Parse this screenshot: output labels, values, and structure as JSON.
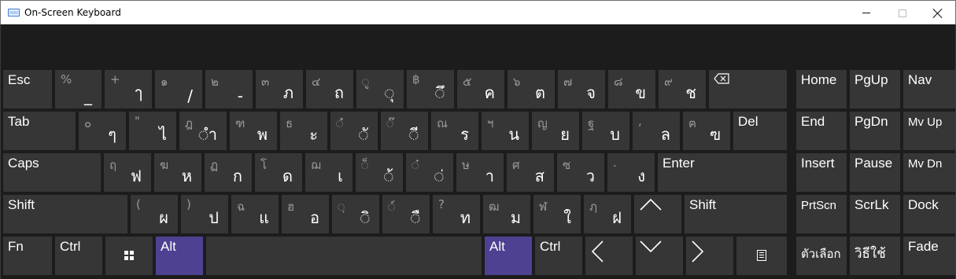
{
  "window": {
    "title": "On-Screen Keyboard",
    "minimize_icon": "minimize-icon",
    "maximize_icon": "maximize-icon",
    "close_icon": "close-icon"
  },
  "colors": {
    "key": "#363636",
    "key_active": "#4e4192",
    "background": "#1c1c1c",
    "shift_char": "#9a9a9a"
  },
  "rows": {
    "row1": [
      {
        "label": "Esc"
      },
      {
        "shift": "%",
        "base": "_"
      },
      {
        "shift": "+",
        "base": "ๅ"
      },
      {
        "shift": "๑",
        "base": "/"
      },
      {
        "shift": "๒",
        "base": "-"
      },
      {
        "shift": "๓",
        "base": "ภ"
      },
      {
        "shift": "๔",
        "base": "ถ"
      },
      {
        "shift": "◌ู",
        "base": "◌ุ"
      },
      {
        "shift": "฿",
        "base": "◌ึ"
      },
      {
        "shift": "๕",
        "base": "ค"
      },
      {
        "shift": "๖",
        "base": "ต"
      },
      {
        "shift": "๗",
        "base": "จ"
      },
      {
        "shift": "๘",
        "base": "ข"
      },
      {
        "shift": "๙",
        "base": "ช"
      },
      {
        "icon": "backspace-icon"
      }
    ],
    "row2": [
      {
        "label": "Tab"
      },
      {
        "shift": "๐",
        "base": "ๆ"
      },
      {
        "shift": "\"",
        "base": "ไ"
      },
      {
        "shift": "ฎ",
        "base": "◌ำ"
      },
      {
        "shift": "ฑ",
        "base": "พ"
      },
      {
        "shift": "ธ",
        "base": "ะ"
      },
      {
        "shift": "◌ํ",
        "base": "◌ั"
      },
      {
        "shift": "◌๊",
        "base": "◌ี"
      },
      {
        "shift": "ณ",
        "base": "ร"
      },
      {
        "shift": "ฯ",
        "base": "น"
      },
      {
        "shift": "ญ",
        "base": "ย"
      },
      {
        "shift": "ฐ",
        "base": "บ"
      },
      {
        "shift": ",",
        "base": "ล"
      },
      {
        "shift": "ฅ",
        "base": "ฃ"
      },
      {
        "label": "Del"
      }
    ],
    "row3": [
      {
        "label": "Caps"
      },
      {
        "shift": "ฤ",
        "base": "ฟ"
      },
      {
        "shift": "ฆ",
        "base": "ห"
      },
      {
        "shift": "ฏ",
        "base": "ก"
      },
      {
        "shift": "โ",
        "base": "ด"
      },
      {
        "shift": "ฌ",
        "base": "เ"
      },
      {
        "shift": "◌็",
        "base": "◌้"
      },
      {
        "shift": "◌๋",
        "base": "◌่"
      },
      {
        "shift": "ษ",
        "base": "า"
      },
      {
        "shift": "ศ",
        "base": "ส"
      },
      {
        "shift": "ซ",
        "base": "ว"
      },
      {
        "shift": ".",
        "base": "ง"
      },
      {
        "label": "Enter"
      }
    ],
    "row4": [
      {
        "label": "Shift"
      },
      {
        "shift": "(",
        "base": "ผ"
      },
      {
        "shift": ")",
        "base": "ป"
      },
      {
        "shift": "ฉ",
        "base": "แ"
      },
      {
        "shift": "ฮ",
        "base": "อ"
      },
      {
        "shift": "◌ฺ",
        "base": "◌ิ"
      },
      {
        "shift": "◌์",
        "base": "◌ื"
      },
      {
        "shift": "?",
        "base": "ท"
      },
      {
        "shift": "ฒ",
        "base": "ม"
      },
      {
        "shift": "ฬ",
        "base": "ใ"
      },
      {
        "shift": "ฦ",
        "base": "ฝ"
      },
      {
        "icon": "up-arrow-icon"
      },
      {
        "label": "Shift"
      }
    ],
    "row5": [
      {
        "label": "Fn"
      },
      {
        "label": "Ctrl"
      },
      {
        "icon": "windows-logo-icon"
      },
      {
        "label": "Alt",
        "active": true
      },
      {
        "icon": "space-bar"
      },
      {
        "label": "Alt",
        "active": true
      },
      {
        "label": "Ctrl"
      },
      {
        "icon": "left-arrow-icon"
      },
      {
        "icon": "down-arrow-icon"
      },
      {
        "icon": "right-arrow-icon"
      },
      {
        "icon": "context-menu-icon"
      }
    ]
  },
  "nav_keys": {
    "row1": [
      "Home",
      "PgUp",
      "Nav"
    ],
    "row2": [
      "End",
      "PgDn",
      "Mv Up"
    ],
    "row3": [
      "Insert",
      "Pause",
      "Mv Dn"
    ],
    "row4": [
      "PrtScn",
      "ScrLk",
      "Dock"
    ],
    "row5": [
      "ตัวเลือก",
      "วิธีใช้",
      "Fade"
    ]
  }
}
